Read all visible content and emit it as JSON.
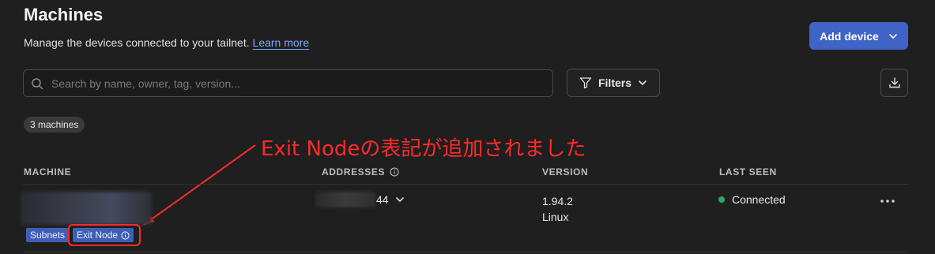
{
  "header": {
    "title": "Machines",
    "subtitle": "Manage the devices connected to your tailnet.",
    "learn_more": "Learn more",
    "add_device": "Add device"
  },
  "toolbar": {
    "search_placeholder": "Search by name, owner, tag, version...",
    "filters": "Filters"
  },
  "count_badge": "3 machines",
  "annotation": "Exit Nodeの表記が追加されました",
  "columns": {
    "machine": "MACHINE",
    "addresses": "ADDRESSES",
    "version": "VERSION",
    "last_seen": "LAST SEEN"
  },
  "row": {
    "address_suffix": "44",
    "version": "1.94.2",
    "os": "Linux",
    "status": "Connected",
    "tags": [
      "Subnets",
      "Exit Node"
    ]
  },
  "colors": {
    "accent": "#3f63c7",
    "tag": "#3f5fb6",
    "status_online": "#2ea86b",
    "annotation": "#ff2a2a"
  },
  "icons": [
    "search-icon",
    "filter-icon",
    "chevron-down-icon",
    "download-icon",
    "info-icon",
    "more-icon"
  ]
}
